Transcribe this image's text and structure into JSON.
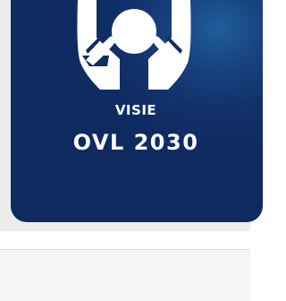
{
  "logo": {
    "icon": "hands-holding-person-icon",
    "subtitle": "VISIE",
    "title": "OVL 2030",
    "colors": {
      "background": "#0e2a5f",
      "glow": "#1f5d9c",
      "foreground": "#ffffff"
    }
  }
}
